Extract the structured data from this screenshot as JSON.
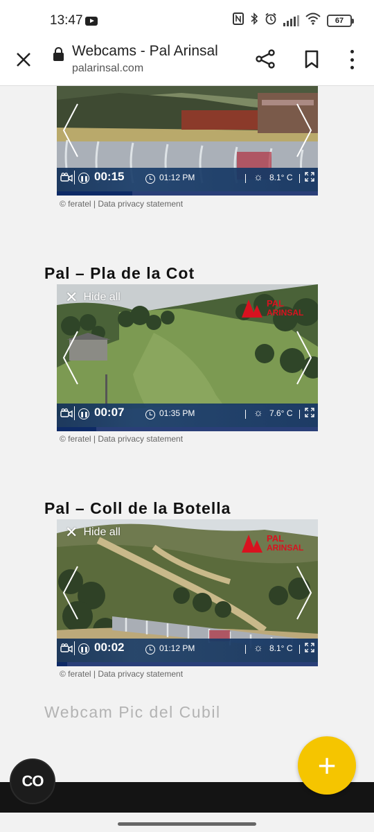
{
  "status_bar": {
    "time": "13:47",
    "battery": "67"
  },
  "browser": {
    "title": "Webcams - Pal Arinsal",
    "url": "palarinsal.com"
  },
  "webcams": [
    {
      "title": "",
      "timer": "00:15",
      "time": "01:12 PM",
      "temperature": "8.1° C",
      "progress": 0.29,
      "hide_all_label": "",
      "credit": "© feratel  |  Data privacy statement"
    },
    {
      "title": "Pal – Pla de la Cot",
      "timer": "00:07",
      "time": "01:35 PM",
      "temperature": "7.6° C",
      "progress": 0.15,
      "hide_all_label": "Hide all",
      "credit": "© feratel  |  Data privacy statement"
    },
    {
      "title": "Pal – Coll de la Botella",
      "timer": "00:02",
      "time": "01:12 PM",
      "temperature": "8.1° C",
      "progress": 0.04,
      "hide_all_label": "Hide all",
      "credit": "© feratel  |  Data privacy statement"
    }
  ],
  "next_section": {
    "title": "Webcam Pic del Cubil"
  },
  "floating": {
    "co_label": "CO",
    "fab_label": "+"
  },
  "colors": {
    "accent_yellow": "#f5c500",
    "brand_red": "#d8121f",
    "cam_bar_blue": "#173a6a"
  }
}
